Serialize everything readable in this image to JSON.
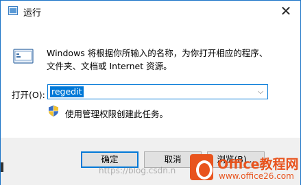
{
  "window": {
    "title": "运行",
    "close_glyph": "✕"
  },
  "description": {
    "line1": "Windows 将根据你所输入的名称，为你打开相应的程序、",
    "line2": "文件夹、文档或 Internet 资源。"
  },
  "open_field": {
    "label": "打开(O):",
    "value": "regedit",
    "dropdown_glyph": "⌵"
  },
  "admin_note": "使用管理权限创建此任务。",
  "buttons": {
    "ok": "确定",
    "cancel": "取消",
    "browse": "浏览(B)..."
  },
  "watermark": {
    "text": "https://blog.csdn.n",
    "brand_name": "Office教程网",
    "brand_url": "www.office26.com"
  },
  "colors": {
    "accent": "#0078d7",
    "brand": "#e8541e"
  },
  "icons": [
    "run-icon",
    "shield-icon",
    "close-icon",
    "chevron-down-icon"
  ]
}
